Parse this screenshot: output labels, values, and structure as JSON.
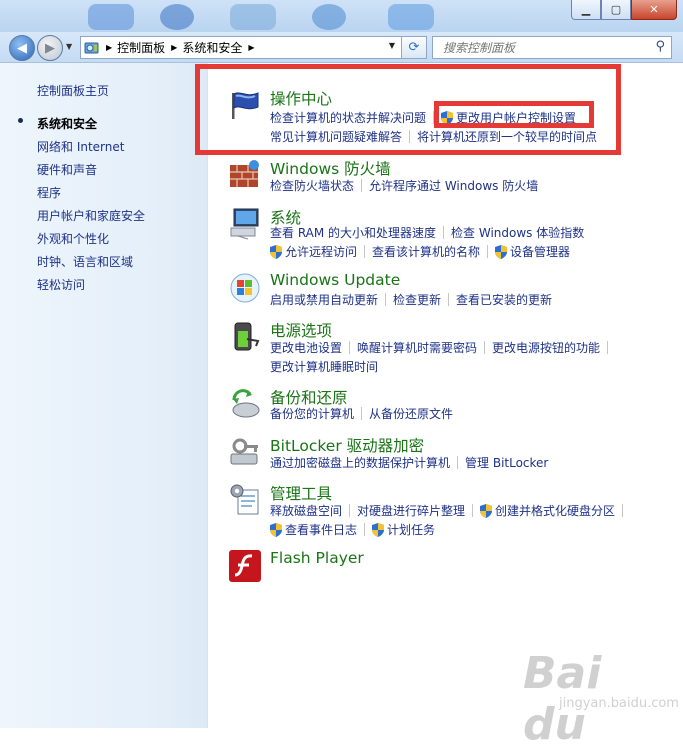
{
  "window": {
    "min_glyph": "▁",
    "max_glyph": "▢",
    "close_glyph": "✕"
  },
  "address": {
    "crumbs": [
      "控制面板",
      "系统和安全"
    ]
  },
  "search": {
    "placeholder": "搜索控制面板"
  },
  "sidebar": {
    "home": "控制面板主页",
    "items": [
      {
        "label": "系统和安全",
        "active": true
      },
      {
        "label": "网络和 Internet"
      },
      {
        "label": "硬件和声音"
      },
      {
        "label": "程序"
      },
      {
        "label": "用户帐户和家庭安全"
      },
      {
        "label": "外观和个性化"
      },
      {
        "label": "时钟、语言和区域"
      },
      {
        "label": "轻松访问"
      }
    ]
  },
  "categories": [
    {
      "title": "操作中心",
      "links_row1": [
        "检查计算机的状态并解决问题",
        "更改用户帐户控制设置"
      ],
      "links_row2": [
        "常见计算机问题疑难解答",
        "将计算机还原到一个较早的时间点"
      ]
    },
    {
      "title": "Windows 防火墙",
      "links_row1": [
        "检查防火墙状态",
        "允许程序通过 Windows 防火墙"
      ]
    },
    {
      "title": "系统",
      "links_row1": [
        "查看 RAM 的大小和处理器速度",
        "检查 Windows 体验指数"
      ],
      "links_row2": [
        "允许远程访问",
        "查看该计算机的名称",
        "设备管理器"
      ]
    },
    {
      "title": "Windows Update",
      "links_row1": [
        "启用或禁用自动更新",
        "检查更新",
        "查看已安装的更新"
      ]
    },
    {
      "title": "电源选项",
      "links_row1": [
        "更改电池设置",
        "唤醒计算机时需要密码",
        "更改电源按钮的功能"
      ],
      "links_row2": [
        "更改计算机睡眠时间"
      ]
    },
    {
      "title": "备份和还原",
      "links_row1": [
        "备份您的计算机",
        "从备份还原文件"
      ]
    },
    {
      "title": "BitLocker 驱动器加密",
      "links_row1": [
        "通过加密磁盘上的数据保护计算机",
        "管理 BitLocker"
      ]
    },
    {
      "title": "管理工具",
      "links_row1": [
        "释放磁盘空间",
        "对硬盘进行碎片整理",
        "创建并格式化硬盘分区"
      ],
      "links_row2": [
        "查看事件日志",
        "计划任务"
      ]
    },
    {
      "title": "Flash Player"
    }
  ],
  "watermark": {
    "big": "Bai du",
    "small": "jingyan.baidu.com"
  },
  "colors": {
    "title_green": "#1a7416",
    "link_blue": "#1e3287",
    "highlight_red": "#e53935"
  }
}
